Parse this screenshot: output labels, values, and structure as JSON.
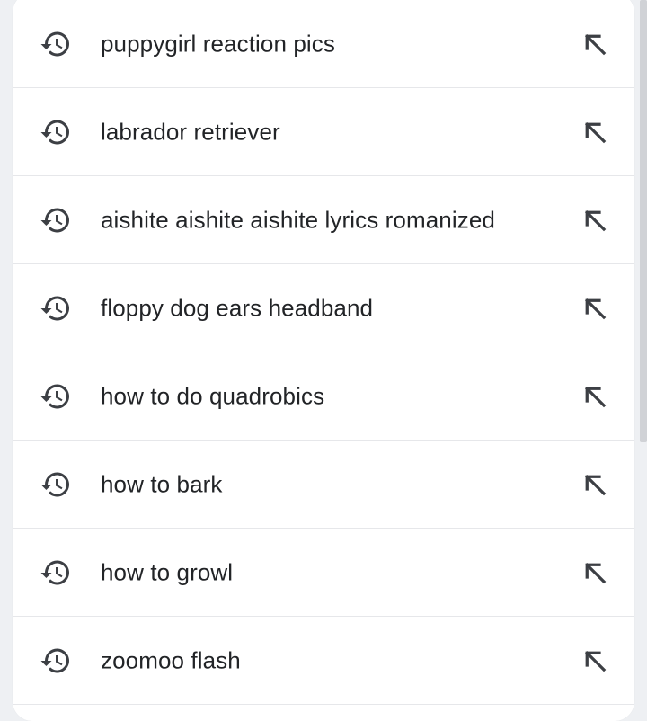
{
  "suggestions": {
    "items": [
      {
        "label": "puppygirl reaction pics",
        "type_icon": "history-icon",
        "action_icon": "arrow-up-left-icon"
      },
      {
        "label": "labrador retriever",
        "type_icon": "history-icon",
        "action_icon": "arrow-up-left-icon"
      },
      {
        "label": "aishite aishite aishite lyrics romanized",
        "type_icon": "history-icon",
        "action_icon": "arrow-up-left-icon"
      },
      {
        "label": "floppy dog ears headband",
        "type_icon": "history-icon",
        "action_icon": "arrow-up-left-icon"
      },
      {
        "label": "how to do quadrobics",
        "type_icon": "history-icon",
        "action_icon": "arrow-up-left-icon"
      },
      {
        "label": "how to bark",
        "type_icon": "history-icon",
        "action_icon": "arrow-up-left-icon"
      },
      {
        "label": "how to growl",
        "type_icon": "history-icon",
        "action_icon": "arrow-up-left-icon"
      },
      {
        "label": "zoomoo flash",
        "type_icon": "history-icon",
        "action_icon": "arrow-up-left-icon"
      }
    ]
  },
  "colors": {
    "background": "#eef0f3",
    "panel": "#ffffff",
    "text": "#222427",
    "icon": "#3c3f44",
    "divider": "#e6e7ea",
    "scrollbar": "#d0d2d6"
  }
}
